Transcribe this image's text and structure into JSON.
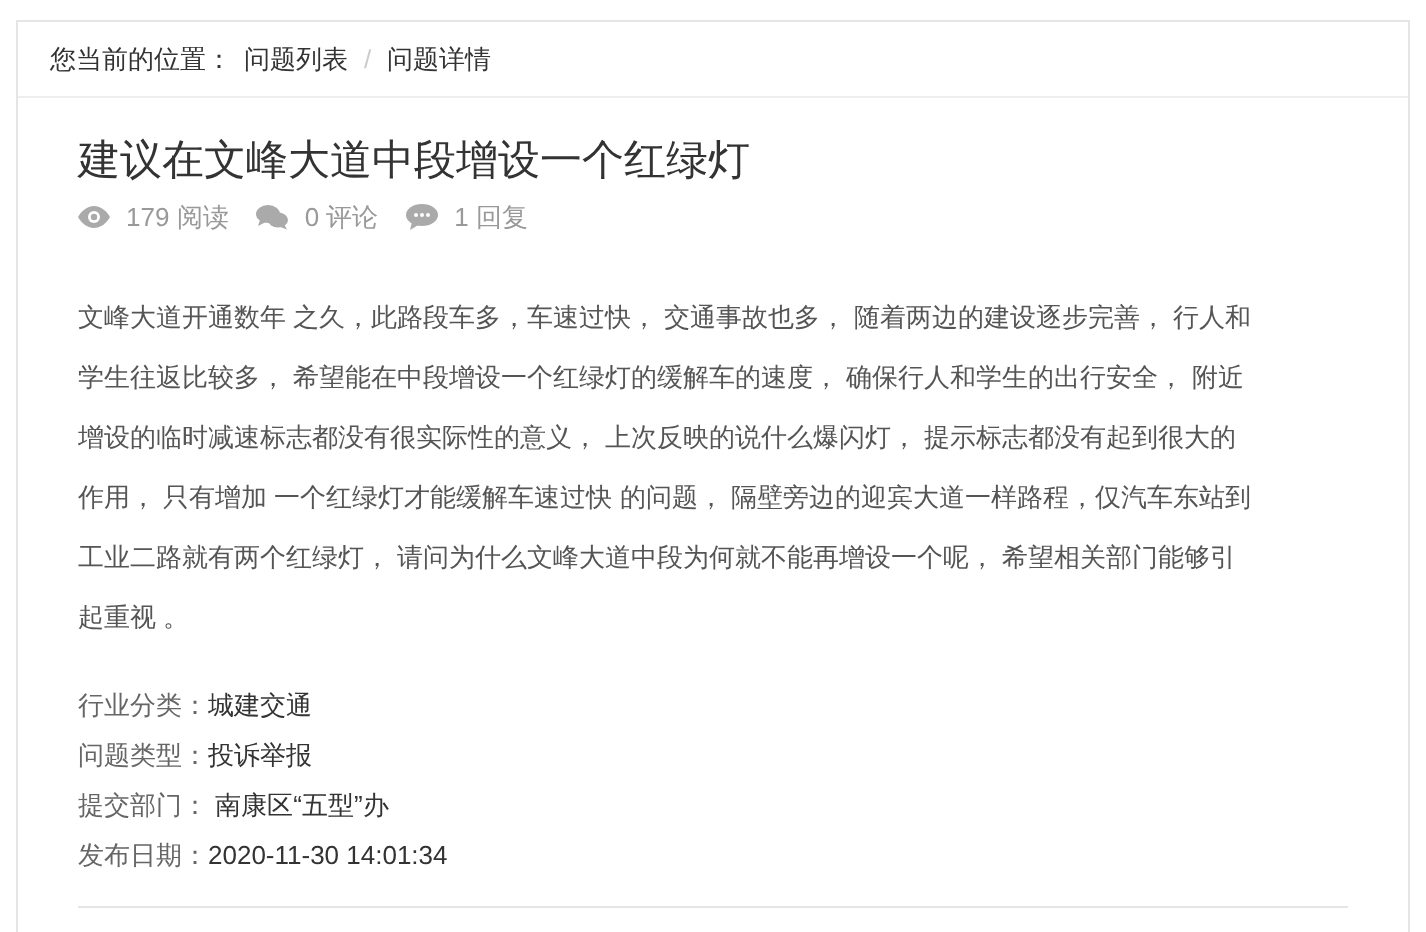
{
  "breadcrumb": {
    "label": "您当前的位置：",
    "items": [
      {
        "text": "问题列表"
      },
      {
        "text": "问题详情"
      }
    ],
    "separator": "/"
  },
  "title": "建议在文峰大道中段增设一个红绿灯",
  "stats": [
    {
      "kind": "views",
      "count": "179",
      "label": "阅读"
    },
    {
      "kind": "comments",
      "count": "0",
      "label": "评论"
    },
    {
      "kind": "replies",
      "count": "1",
      "label": "回复"
    }
  ],
  "body_lines": [
    "文峰大道开通数年 之久，此路段车多，车速过快， 交通事故也多， 随着两边的建设逐步完善， 行人和",
    "学生往返比较多， 希望能在中段增设一个红绿灯的缓解车的速度， 确保行人和学生的出行安全， 附近",
    "增设的临时减速标志都没有很实际性的意义， 上次反映的说什么爆闪灯， 提示标志都没有起到很大的",
    "作用， 只有增加 一个红绿灯才能缓解车速过快 的问题， 隔壁旁边的迎宾大道一样路程，仅汽车东站到",
    "工业二路就有两个红绿灯， 请问为什么文峰大道中段为何就不能再增设一个呢， 希望相关部门能够引",
    "起重视 。"
  ],
  "details": [
    {
      "label": "行业分类：",
      "value": "城建交通"
    },
    {
      "label": "问题类型：",
      "value": "投诉举报"
    },
    {
      "label": "提交部门：",
      "value": " 南康区“五型”办"
    },
    {
      "label": "发布日期：",
      "value": "2020-11-30 14:01:34"
    }
  ]
}
